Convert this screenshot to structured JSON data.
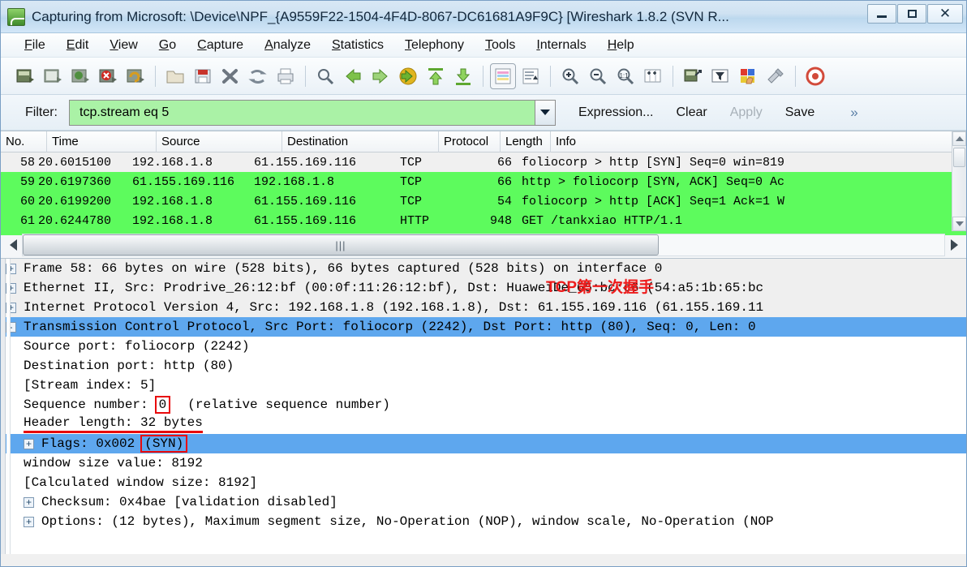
{
  "window": {
    "title": "Capturing from Microsoft: \\Device\\NPF_{A9559F22-1504-4F4D-8067-DC61681A9F9C}   [Wireshark 1.8.2  (SVN R...",
    "app_icon": "wireshark-icon",
    "minimize_label": "—",
    "maximize_label": "□",
    "close_label": "✕"
  },
  "menu": [
    {
      "pre": "",
      "key": "F",
      "post": "ile"
    },
    {
      "pre": "",
      "key": "E",
      "post": "dit"
    },
    {
      "pre": "",
      "key": "V",
      "post": "iew"
    },
    {
      "pre": "",
      "key": "G",
      "post": "o"
    },
    {
      "pre": "",
      "key": "C",
      "post": "apture"
    },
    {
      "pre": "",
      "key": "A",
      "post": "nalyze"
    },
    {
      "pre": "",
      "key": "S",
      "post": "tatistics"
    },
    {
      "pre": "",
      "key": "T",
      "post": "elephony"
    },
    {
      "pre": "",
      "key": "T",
      "post": "ools"
    },
    {
      "pre": "",
      "key": "I",
      "post": "nternals"
    },
    {
      "pre": "",
      "key": "H",
      "post": "elp"
    }
  ],
  "toolbar": {
    "buttons": [
      "interfaces-icon",
      "options-icon",
      "start-capture-icon",
      "stop-capture-icon",
      "restart-capture-icon",
      "open-file-icon",
      "save-file-icon",
      "close-file-icon",
      "reload-icon",
      "print-icon",
      "find-packet-icon",
      "go-back-icon",
      "go-forward-icon",
      "go-to-packet-icon",
      "go-first-packet-icon",
      "go-last-packet-icon",
      "colorize-icon",
      "auto-scroll-icon",
      "zoom-in-icon",
      "zoom-out-icon",
      "zoom-reset-icon",
      "resize-columns-icon",
      "capture-filters-icon",
      "display-filters-icon",
      "coloring-rules-icon",
      "preferences-icon",
      "help-icon"
    ]
  },
  "filter": {
    "label": "Filter:",
    "value": "tcp.stream eq 5",
    "placeholder": "",
    "dropdown_icon": "chevron-down-icon",
    "expression_label": "Expression...",
    "clear_label": "Clear",
    "apply_label": "Apply",
    "save_label": "Save",
    "more_label": "»"
  },
  "packet_list": {
    "columns": [
      "No.",
      "Time",
      "Source",
      "Destination",
      "Protocol",
      "Length",
      "Info"
    ],
    "rows": [
      {
        "no": "58",
        "time": "20.6015100",
        "source": "192.168.1.8",
        "destination": "61.155.169.116",
        "protocol": "TCP",
        "length": "66",
        "info": "foliocorp > http [SYN] Seq=0 win=819",
        "state": "odd"
      },
      {
        "no": "59",
        "time": "20.6197360",
        "source": "61.155.169.116",
        "destination": "192.168.1.8",
        "protocol": "TCP",
        "length": "66",
        "info": "http > foliocorp [SYN, ACK] Seq=0 Ac",
        "state": "green"
      },
      {
        "no": "60",
        "time": "20.6199200",
        "source": "192.168.1.8",
        "destination": "61.155.169.116",
        "protocol": "TCP",
        "length": "54",
        "info": "foliocorp > http [ACK] Seq=1 Ack=1 W",
        "state": "green"
      },
      {
        "no": "61",
        "time": "20.6244780",
        "source": "192.168.1.8",
        "destination": "61.155.169.116",
        "protocol": "HTTP",
        "length": "948",
        "info": "GET /tankxiao HTTP/1.1",
        "state": "green"
      }
    ]
  },
  "hscroll": {
    "left_icon": "arrow-left-icon",
    "right_icon": "arrow-right-icon",
    "grip": "|||"
  },
  "detail": {
    "rows": [
      {
        "expander": "+",
        "text": "Frame 58: 66 bytes on wire (528 bits), 66 bytes captured (528 bits) on interface 0",
        "style": "alt"
      },
      {
        "expander": "+",
        "text": "Ethernet II, Src: Prodrive_26:12:bf (00:0f:11:26:12:bf), Dst: HuaweiDe_65:bc:c6 (54:a5:1b:65:bc",
        "style": "alt"
      },
      {
        "expander": "+",
        "text": "Internet Protocol Version 4, Src: 192.168.1.8 (192.168.1.8), Dst: 61.155.169.116 (61.155.169.11",
        "style": "alt"
      },
      {
        "expander": "-",
        "text": "Transmission Control Protocol, Src Port: foliocorp (2242), Dst Port: http (80), Seq: 0, Len: 0",
        "style": "sel"
      },
      {
        "expander": "",
        "text": "Source port: foliocorp (2242)",
        "style": "child"
      },
      {
        "expander": "",
        "text": "Destination port: http (80)",
        "style": "child"
      },
      {
        "expander": "",
        "text": "[Stream index: 5]",
        "style": "child"
      },
      {
        "expander": "",
        "text": "Header length: 32 bytes",
        "style": "child"
      },
      {
        "expander": "",
        "text": "window size value: 8192",
        "style": "child"
      },
      {
        "expander": "",
        "text": "[Calculated window size: 8192]",
        "style": "child"
      },
      {
        "expander": "+",
        "text": "Checksum: 0x4bae [validation disabled]",
        "style": "child"
      },
      {
        "expander": "+",
        "text": "Options: (12 bytes), Maximum segment size, No-Operation (NOP), window scale, No-Operation (NOP",
        "style": "child"
      }
    ],
    "seq_row": {
      "label": "Sequence number:",
      "highlight_value": "0",
      "suffix": "(relative sequence number)"
    },
    "flags_row": {
      "expander": "+",
      "label": "Flags: 0x002",
      "highlight_value": "(SYN)"
    },
    "annotation": "TCP第一次握手"
  },
  "colors": {
    "green_row": "#5dfb5d",
    "selected_row": "#5ea7ee",
    "filter_bg": "#aaf2a6",
    "annotation_red": "#ee1b1b",
    "highlight_border": "#e8090b"
  }
}
